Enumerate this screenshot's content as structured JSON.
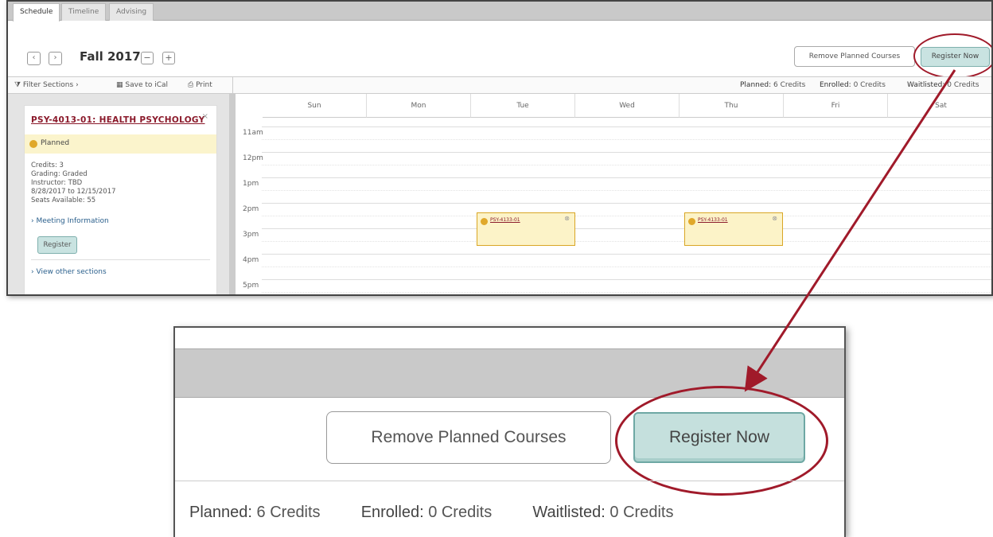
{
  "tabs": [
    "Schedule",
    "Timeline",
    "Advising"
  ],
  "term": {
    "title": "Fall 2017",
    "prev_label": "‹",
    "next_label": "›",
    "collapse_label": "−",
    "expand_label": "+"
  },
  "buttons": {
    "remove_planned": "Remove Planned Courses",
    "register_now": "Register Now"
  },
  "toolbar": {
    "filter": "Filter Sections",
    "filter_caret": "›",
    "ical": "Save to iCal",
    "print": "Print"
  },
  "credits": {
    "planned_label": "Planned:",
    "planned_value": "6 Credits",
    "enrolled_label": "Enrolled:",
    "enrolled_value": "0 Credits",
    "waitlisted_label": "Waitlisted:",
    "waitlisted_value": "0 Credits"
  },
  "course": {
    "title": "PSY-4013-01: HEALTH PSYCHOLOGY",
    "close": "×",
    "status": "Planned",
    "credits": "Credits: 3",
    "grading": "Grading: Graded",
    "instructor": "Instructor: TBD",
    "dates": "8/28/2017 to 12/15/2017",
    "seats": "Seats Available:  55",
    "meeting_link": "Meeting Information",
    "register": "Register",
    "view_other": "View other sections"
  },
  "calendar": {
    "days": [
      "Sun",
      "Mon",
      "Tue",
      "Wed",
      "Thu",
      "Fri",
      "Sat"
    ],
    "hours": [
      "11am",
      "12pm",
      "1pm",
      "2pm",
      "3pm",
      "4pm",
      "5pm"
    ],
    "events": [
      {
        "day": "Tue",
        "code": "PSY-4133-01"
      },
      {
        "day": "Thu",
        "code": "PSY-4133-01"
      }
    ]
  },
  "colors": {
    "annotation": "#a01a2a",
    "register_bg": "#c9e3e1",
    "planned_bg": "#fbf4cc",
    "course_title": "#8b1a2b"
  }
}
